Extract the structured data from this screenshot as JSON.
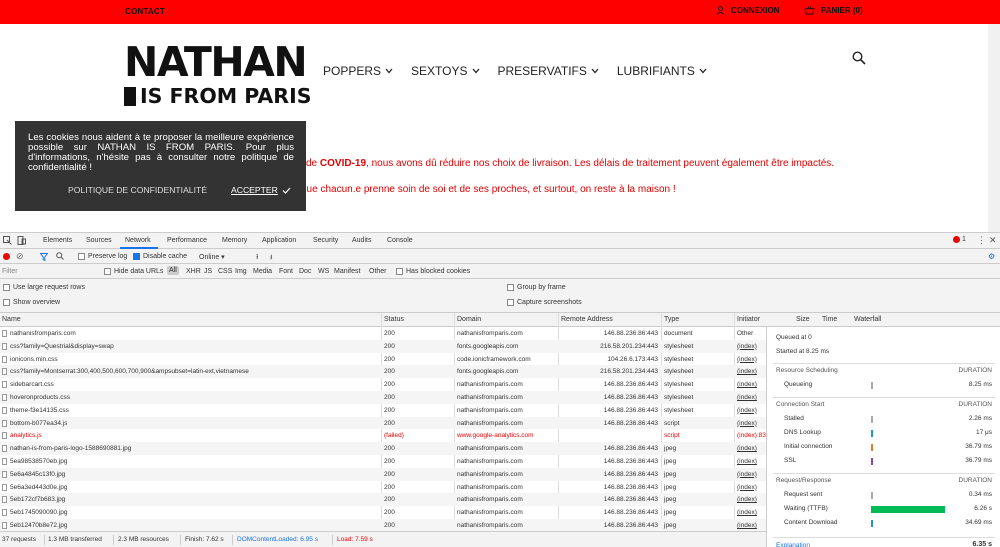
{
  "site": {
    "topbar": {
      "contact": "CONTACT",
      "connexion": "CONNEXION",
      "panier": "PANIER (0)"
    },
    "logo": {
      "line1": "NATHAN",
      "line2": "IS FROM PARIS"
    },
    "nav": [
      "POPPERS",
      "SEXTOYS",
      "PRESERVATIFS",
      "LUBRIFIANTS"
    ],
    "notice": {
      "prefix": "de ",
      "highlight": "COVID-19",
      "line1_rest": ", nous avons dû réduire nos choix de livraison. Les délais de traitement peuvent également être impactés.",
      "line2": "que chacun.e prenne soin de soi et de ses proches, et surtout, on reste à la maison !"
    },
    "cookie": {
      "text": "Les cookies nous aident à te proposer la meilleure expérience possible sur NATHAN IS FROM PARIS. Pour plus d'informations, n'hésite pas à consulter notre politique de confidentialité !",
      "policy": "POLITIQUE DE CONFIDENTIALITÉ",
      "accept": "ACCEPTER"
    },
    "colors": {
      "topbar": "#ff0000",
      "notice": "#e40000",
      "cookie_bg": "#333333"
    }
  },
  "devtools": {
    "tabs": [
      "Elements",
      "Sources",
      "Network",
      "Performance",
      "Memory",
      "Application",
      "Security",
      "Audits",
      "Console"
    ],
    "active_tab": "Network",
    "error_count": "1",
    "toolbar": {
      "preserve_log": "Preserve log",
      "disable_cache": "Disable cache",
      "throttle": "Online"
    },
    "filter": {
      "placeholder": "Filter",
      "hide_data_urls": "Hide data URLs",
      "types": [
        "All",
        "XHR",
        "JS",
        "CSS",
        "Img",
        "Media",
        "Font",
        "Doc",
        "WS",
        "Manifest",
        "Other"
      ],
      "blocked_cookies": "Has blocked cookies"
    },
    "options": {
      "large_rows": "Use large request rows",
      "group_by_frame": "Group by frame",
      "show_overview": "Show overview",
      "capture_screenshots": "Capture screenshots"
    },
    "columns": [
      "Name",
      "Status",
      "Domain",
      "Remote Address",
      "Type",
      "Initiator",
      "Size",
      "Time",
      "Waterfall"
    ],
    "rows": [
      {
        "name": "nathanisfromparis.com",
        "status": "200",
        "domain": "nathanisfromparis.com",
        "remote": "146.88.236.86:443",
        "type": "document",
        "initiator": "Other"
      },
      {
        "name": "css?family=Questrial&display=swap",
        "status": "200",
        "domain": "fonts.googleapis.com",
        "remote": "216.58.201.234:443",
        "type": "stylesheet",
        "initiator": "(index)"
      },
      {
        "name": "ionicons.min.css",
        "status": "200",
        "domain": "code.ionicframework.com",
        "remote": "104.26.6.173:443",
        "type": "stylesheet",
        "initiator": "(index)"
      },
      {
        "name": "css?family=Montserrat:300,400,500,600,700,900&ampsubset=latin-ext,vietnamese",
        "status": "200",
        "domain": "fonts.googleapis.com",
        "remote": "216.58.201.234:443",
        "type": "stylesheet",
        "initiator": "(index)"
      },
      {
        "name": "sidebarcart.css",
        "status": "200",
        "domain": "nathanisfromparis.com",
        "remote": "146.88.236.86:443",
        "type": "stylesheet",
        "initiator": "(index)"
      },
      {
        "name": "hoveronproducts.css",
        "status": "200",
        "domain": "nathanisfromparis.com",
        "remote": "146.88.236.86:443",
        "type": "stylesheet",
        "initiator": "(index)"
      },
      {
        "name": "theme-f3e14135.css",
        "status": "200",
        "domain": "nathanisfromparis.com",
        "remote": "146.88.236.86:443",
        "type": "stylesheet",
        "initiator": "(index)"
      },
      {
        "name": "bottom-b077ea34.js",
        "status": "200",
        "domain": "nathanisfromparis.com",
        "remote": "146.88.236.86:443",
        "type": "script",
        "initiator": "(index)"
      },
      {
        "name": "analytics.js",
        "status": "(failed)",
        "domain": "www.google-analytics.com",
        "remote": "",
        "type": "script",
        "initiator": "(index):83",
        "failed": true
      },
      {
        "name": "nathan-is-from-paris-logo-1588690881.jpg",
        "status": "200",
        "domain": "nathanisfromparis.com",
        "remote": "146.88.236.86:443",
        "type": "jpeg",
        "initiator": "(index)"
      },
      {
        "name": "5ea98538570eb.jpg",
        "status": "200",
        "domain": "nathanisfromparis.com",
        "remote": "146.88.236.86:443",
        "type": "jpeg",
        "initiator": "(index)"
      },
      {
        "name": "5e6a4845c13f0.jpg",
        "status": "200",
        "domain": "nathanisfromparis.com",
        "remote": "146.88.236.86:443",
        "type": "jpeg",
        "initiator": "(index)"
      },
      {
        "name": "5e6a3ed443d0e.jpg",
        "status": "200",
        "domain": "nathanisfromparis.com",
        "remote": "146.88.236.86:443",
        "type": "jpeg",
        "initiator": "(index)"
      },
      {
        "name": "5eb172cf7b683.jpg",
        "status": "200",
        "domain": "nathanisfromparis.com",
        "remote": "146.88.236.86:443",
        "type": "jpeg",
        "initiator": "(index)"
      },
      {
        "name": "5eb1745090090.jpg",
        "status": "200",
        "domain": "nathanisfromparis.com",
        "remote": "146.88.236.86:443",
        "type": "jpeg",
        "initiator": "(index)"
      },
      {
        "name": "5eb12470b8e72.jpg",
        "status": "200",
        "domain": "nathanisfromparis.com",
        "remote": "146.88.236.86:443",
        "type": "jpeg",
        "initiator": "(index)"
      }
    ],
    "statusbar": {
      "requests": "37 requests",
      "transferred": "1.3 MB transferred",
      "resources": "2.3 MB resources",
      "finish": "Finish: 7.62 s",
      "domloaded": "DOMContentLoaded: 6.95 s",
      "load": "Load: 7.59 s"
    },
    "timing": {
      "queued": "Queued at 0",
      "started": "Started at 8.25 ms",
      "sections": [
        {
          "title": "Resource Scheduling",
          "dur_label": "DURATION",
          "items": [
            {
              "label": "Queueing",
              "value": "8.25 ms",
              "fill": 0.01,
              "color": "#aaaaaa"
            }
          ]
        },
        {
          "title": "Connection Start",
          "dur_label": "DURATION",
          "items": [
            {
              "label": "Stalled",
              "value": "2.26 ms",
              "fill": 0.005,
              "color": "#aaaaaa"
            },
            {
              "label": "DNS Lookup",
              "value": "17 μs",
              "fill": 0.005,
              "color": "#1f9bc0"
            },
            {
              "label": "Initial connection",
              "value": "36.79 ms",
              "fill": 0.01,
              "color": "#e67e22"
            },
            {
              "label": "SSL",
              "value": "36.79 ms",
              "fill": 0.01,
              "color": "#8e44ad"
            }
          ]
        },
        {
          "title": "Request/Response",
          "dur_label": "DURATION",
          "items": [
            {
              "label": "Request sent",
              "value": "0.34 ms",
              "fill": 0.005,
              "color": "#aaaaaa"
            },
            {
              "label": "Waiting (TTFB)",
              "value": "6.26 s",
              "fill": 1,
              "color": "#00bb55"
            },
            {
              "label": "Content Download",
              "value": "34.69 ms",
              "fill": 0.01,
              "color": "#1f9bc0"
            }
          ]
        }
      ],
      "explanation": "Explanation",
      "total": "6.35 s"
    }
  }
}
